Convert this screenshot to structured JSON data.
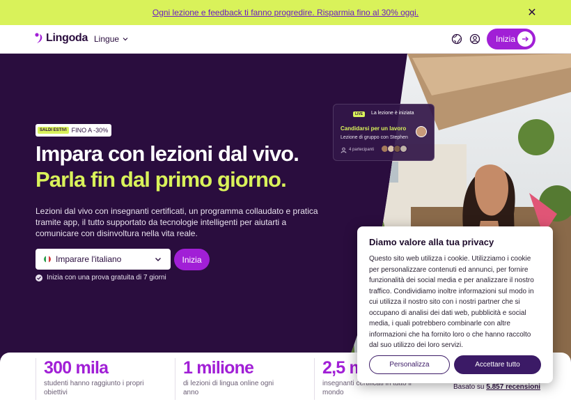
{
  "promo": {
    "text": "Ogni lezione e feedback ti fanno progredire. Risparmia fino al 30% oggi.",
    "close_icon": "close-icon"
  },
  "header": {
    "logo_text": "Lingoda",
    "languages_label": "Lingue",
    "start_label": "Inizia",
    "icons": [
      "globe-icon",
      "user-icon",
      "arrow-right-icon",
      "chevron-down-icon"
    ]
  },
  "hero": {
    "badge_tag": "SALDI ESTIVI",
    "badge_text": "FINO A -30%",
    "title_line1": "Impara con lezioni dal vivo.",
    "title_line2": "Parla fin dal primo giorno.",
    "description": "Lezioni dal vivo con insegnanti certificati, un programma collaudato e pratica tramite app, il tutto supportato da tecnologie intelligenti per aiutarti a comunicare con disinvoltura nella vita reale.",
    "language_select": "Imparare l'italiano",
    "start_label": "Inizia",
    "trial_text": "Inizia con una prova gratuita di 7 giorni"
  },
  "live_card": {
    "live_tag": "LIVE",
    "status": "La lezione è iniziata",
    "lesson_title": "Candidarsi per un lavoro",
    "lesson_sub": "Lezione di gruppo con Stephen",
    "participants": "4 partecipanti"
  },
  "stats": [
    {
      "number": "300 mila",
      "label": "studenti hanno raggiunto i propri obiettivi"
    },
    {
      "number": "1 milione",
      "label": "di lezioni di lingua online ogni anno"
    },
    {
      "number": "2,5 m",
      "label": "insegnanti certificati in tutto il mondo"
    }
  ],
  "reviews": {
    "prefix": "Basato su",
    "link": "5.857 recensioni"
  },
  "cookie": {
    "title": "Diamo valore alla tua privacy",
    "body": "Questo sito web utilizza i cookie. Utilizziamo i cookie per personalizzare contenuti ed annunci, per fornire funzionalità dei social media e per analizzare il nostro traffico. Condividiamo inoltre informazioni sul modo in cui utilizza il nostro sito con i nostri partner che si occupano di analisi dei dati web, pubblicità e social media, i quali potrebbero combinarle con altre informazioni che ha fornito loro o che hanno raccolto dal suo utilizzo dei loro servizi.",
    "customize_label": "Personalizza",
    "accept_label": "Accettare tutto"
  },
  "colors": {
    "brand_purple": "#a11fd6",
    "dark_purple": "#2a0d3e",
    "lime": "#d9f25a",
    "cookie_button": "#3b1a66"
  }
}
